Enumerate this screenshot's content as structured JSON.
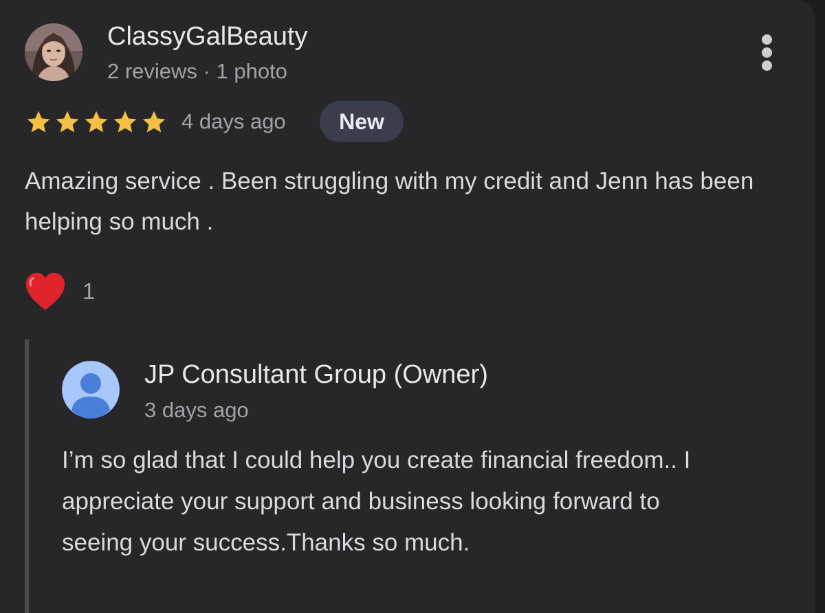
{
  "review": {
    "reviewer": {
      "name": "ClassyGalBeauty",
      "meta": "2 reviews · 1 photo"
    },
    "rating": 5,
    "rating_max": 5,
    "star_color": "#f5c044",
    "date": "4 days ago",
    "badge": "New",
    "text": "Amazing service . Been struggling with my credit and Jenn has been helping so much .",
    "reaction": {
      "icon": "heart-icon",
      "count": "1"
    },
    "menu_icon": "more-vert-icon"
  },
  "owner_reply": {
    "name": "JP Consultant Group (Owner)",
    "date": "3 days ago",
    "avatar_icon": "person-icon",
    "text": "I’m so glad that I could help you create financial freedom.. I appreciate your support and business looking forward to seeing your success.Thanks so much."
  },
  "colors": {
    "background": "#27272a",
    "badge_bg": "#3a3e4c",
    "heart": "#e0242b",
    "owner_avatar_bg": "#a8c7fa",
    "owner_avatar_fg": "#4a7fd9"
  }
}
